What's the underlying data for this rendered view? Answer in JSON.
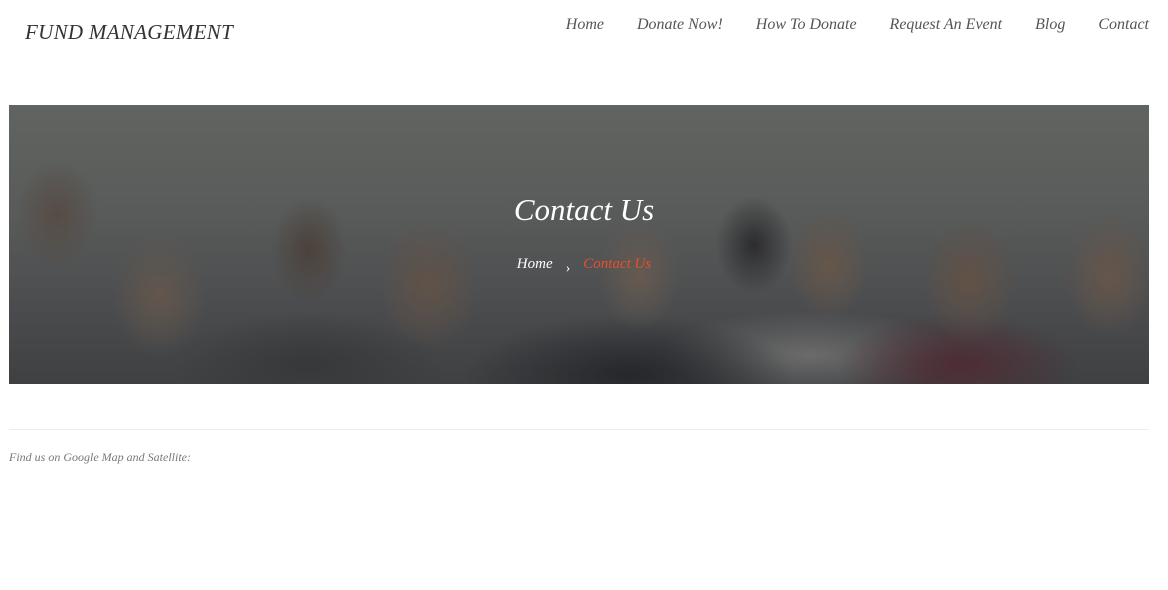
{
  "header": {
    "logo_text": "FUND MANAGEMENT",
    "nav": [
      {
        "label": "Home"
      },
      {
        "label": "Donate Now!"
      },
      {
        "label": "How To Donate"
      },
      {
        "label": "Request An Event"
      },
      {
        "label": "Blog"
      },
      {
        "label": "Contact"
      }
    ]
  },
  "hero": {
    "title": "Contact Us",
    "breadcrumb": {
      "home": "Home",
      "separator": "›",
      "current": "Contact Us"
    }
  },
  "content": {
    "map_label": "Find us on Google Map and Satellite:"
  },
  "colors": {
    "accent": "#e8502a",
    "text": "#555555"
  }
}
